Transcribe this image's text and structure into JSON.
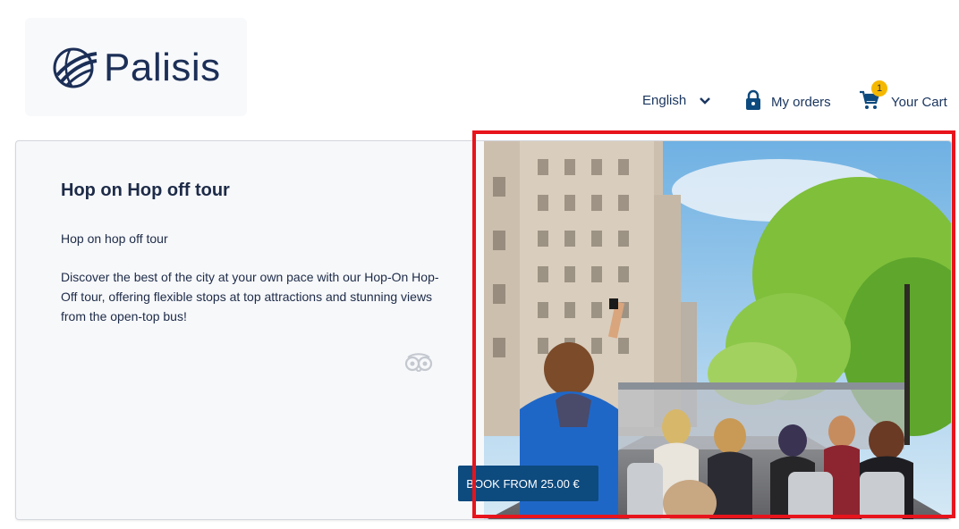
{
  "brand": {
    "name": "Palisis",
    "logo_icon": "globe-swoosh-icon"
  },
  "nav": {
    "language": {
      "label": "English",
      "icon": "chevron-down-icon"
    },
    "orders": {
      "label": "My orders",
      "icon": "lock-icon"
    },
    "cart": {
      "label": "Your Cart",
      "icon": "cart-icon",
      "count": "1"
    }
  },
  "product": {
    "title": "Hop on Hop off tour",
    "subtitle": "Hop on hop off tour",
    "description": "Discover the best of the city at your own pace with our Hop-On Hop-Off tour, offering flexible stops at top attractions and stunning views from the open-top bus!",
    "review_icon": "tripadvisor-icon",
    "book_button": "BOOK FROM 25.00 €",
    "image_alt": "Tourists on an open-top double-decker bus driving along a tree-lined avenue next to tall buildings"
  },
  "colors": {
    "navy": "#1c2f57",
    "button": "#0d4a7e",
    "badge": "#f5b800",
    "highlight": "#e8141c"
  }
}
